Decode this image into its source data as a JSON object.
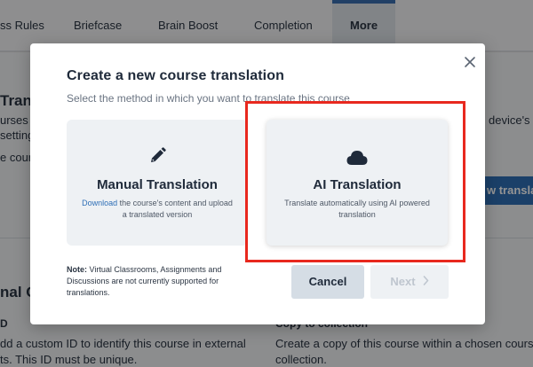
{
  "tabs": [
    {
      "label": "ss Rules"
    },
    {
      "label": "Briefcase"
    },
    {
      "label": "Brain Boost"
    },
    {
      "label": "Completion"
    },
    {
      "label": "More"
    }
  ],
  "background": {
    "heading_fragment": "Transl",
    "line1": "urses an",
    "line2": " setting",
    "line3": "e cours",
    "right_fragment": "device's",
    "button_fragment": "w transla",
    "section_fragment": "nal O",
    "id_label": "D",
    "id_text1": "dd a custom ID to identify this course in external",
    "id_text2": "ts. This ID must be unique.",
    "copy_label": "Copy to collection",
    "copy_text1": "Create a copy of this course within a chosen course",
    "copy_text2": "collection."
  },
  "modal": {
    "title": "Create a new course translation",
    "subtitle": "Select the method in which you want to translate this course",
    "close_icon": "close-icon",
    "options": [
      {
        "icon": "pencil-icon",
        "title": "Manual Translation",
        "desc_link": "Download",
        "desc_rest": " the course's content and upload a translated version"
      },
      {
        "icon": "cloud-icon",
        "title": "AI Translation",
        "desc": "Translate automatically using AI powered translation"
      }
    ],
    "note_bold": "Note:",
    "note_text": " Virtual Classrooms, Assignments and Discussions are not currently supported for translations.",
    "cancel_label": "Cancel",
    "next_label": "Next"
  },
  "colors": {
    "highlight": "#e8281e",
    "link": "#2f6fb6",
    "accent_tab": "#3a6fb0"
  }
}
